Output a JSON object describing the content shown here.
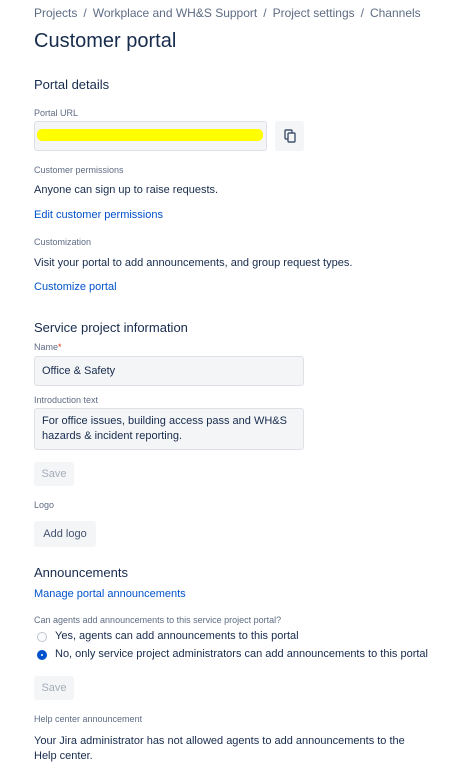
{
  "breadcrumbs": [
    "Projects",
    "Workplace and WH&S Support",
    "Project settings",
    "Channels"
  ],
  "page_title": "Customer portal",
  "portal_details": {
    "heading": "Portal details",
    "url_label": "Portal URL",
    "url_value": ""
  },
  "customer_permissions": {
    "label": "Customer permissions",
    "text": "Anyone can sign up to raise requests.",
    "link": "Edit customer permissions"
  },
  "customization": {
    "label": "Customization",
    "text": "Visit your portal to add announcements, and group request types.",
    "link": "Customize portal"
  },
  "service_info": {
    "heading": "Service project information",
    "name_label": "Name",
    "required_mark": "*",
    "name_value": "Office & Safety",
    "intro_label": "Introduction text",
    "intro_value": "For office issues, building access pass and WH&S hazards & incident reporting.",
    "save_label": "Save"
  },
  "logo": {
    "label": "Logo",
    "button": "Add logo"
  },
  "announcements": {
    "heading": "Announcements",
    "manage_link": "Manage portal announcements",
    "question": "Can agents add announcements to this service project portal?",
    "option_yes": "Yes, agents can add announcements to this portal",
    "option_no": "No, only service project administrators can add announcements to this portal",
    "selected": "no",
    "save_label": "Save"
  },
  "help_center": {
    "label": "Help center announcement",
    "text": "Your Jira administrator has not allowed agents to add announcements to the Help center."
  },
  "colors": {
    "link": "#0052cc",
    "text": "#172b4d",
    "subtle": "#5e6c84",
    "redaction": "#ffff00"
  }
}
